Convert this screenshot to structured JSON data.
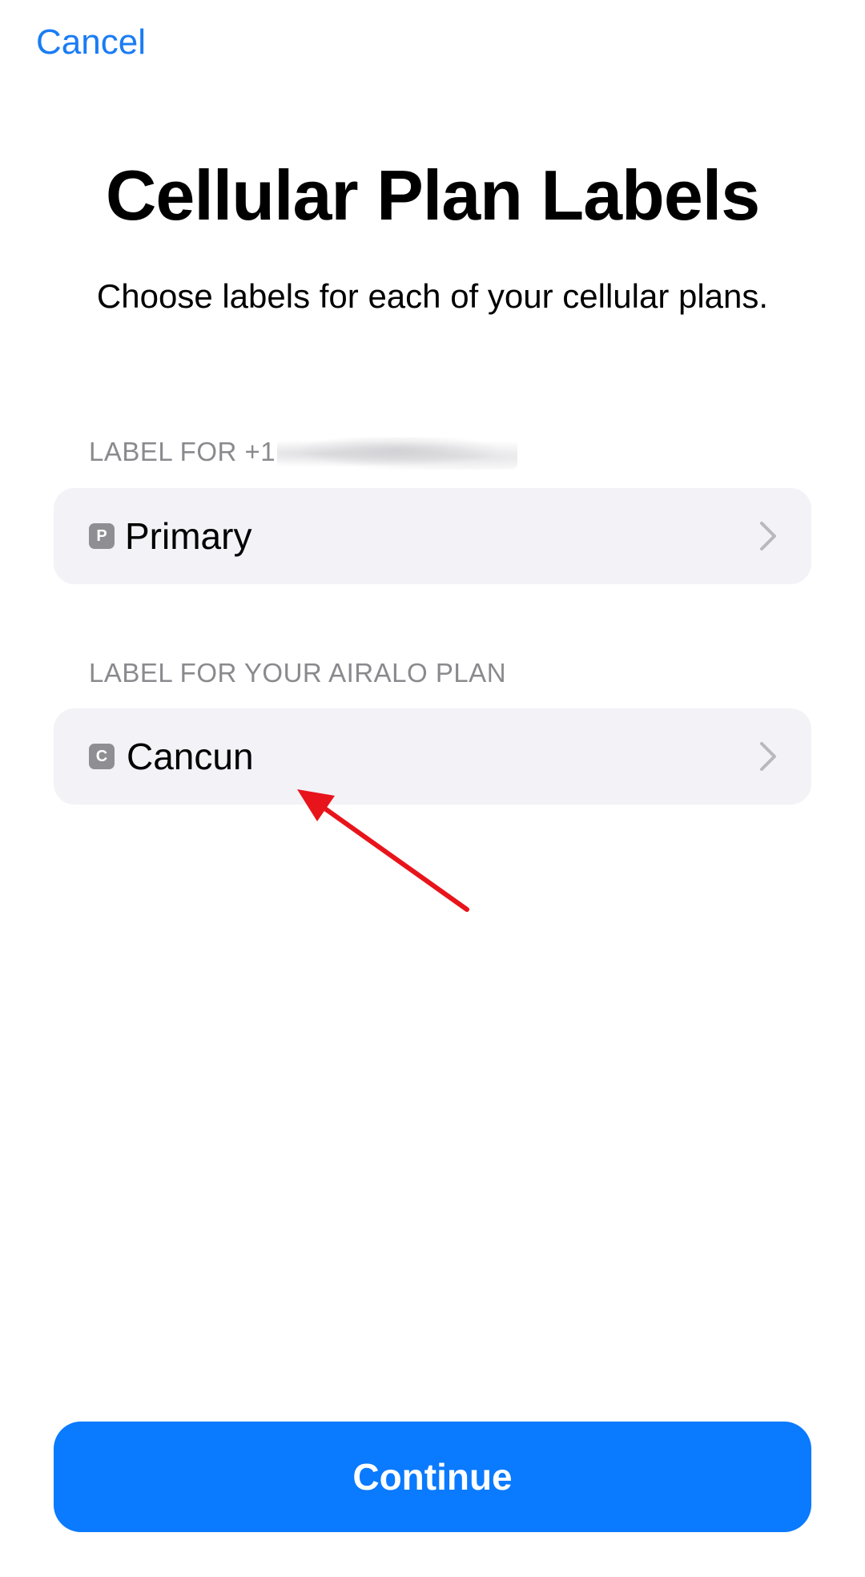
{
  "header": {
    "cancel_label": "Cancel"
  },
  "title": "Cellular Plan Labels",
  "subtitle": "Choose labels for each of your cellular plans.",
  "sections": [
    {
      "header_prefix": "LABEL FOR +1",
      "row": {
        "badge": "P",
        "label": "Primary"
      }
    },
    {
      "header": "LABEL FOR YOUR AIRALO PLAN",
      "row": {
        "badge": "C",
        "label": "Cancun"
      }
    }
  ],
  "footer": {
    "continue_label": "Continue"
  },
  "colors": {
    "accent": "#0a7aff",
    "link": "#1a7cf5",
    "annotation_arrow": "#e8141b",
    "row_background": "#f2f2f7",
    "secondary_text": "#8a8a8e"
  },
  "icons": {
    "chevron": "chevron-right-icon",
    "annotation": "red-arrow-annotation"
  }
}
